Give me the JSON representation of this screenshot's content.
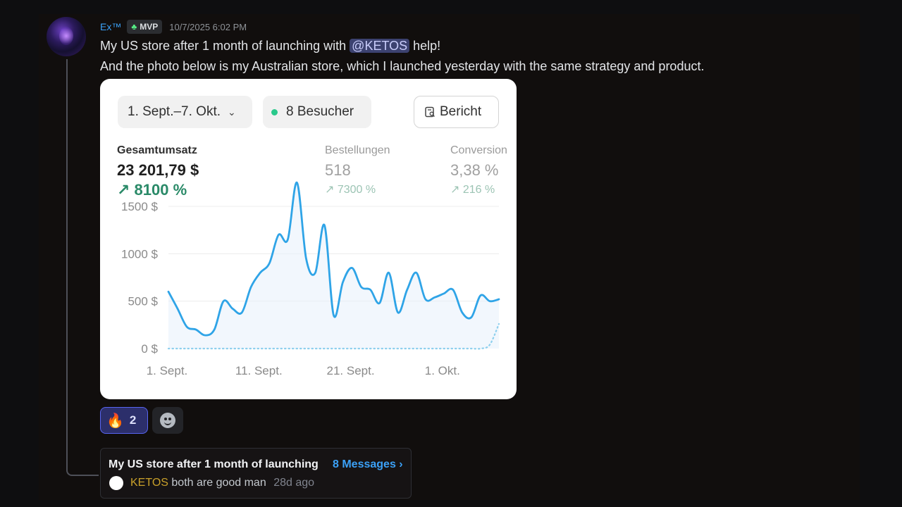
{
  "message": {
    "username": "Ex™",
    "badge_label": "MVP",
    "timestamp": "10/7/2025 6:02 PM",
    "line1_before": "My US store after 1 month of launching with ",
    "mention": "@KETOS",
    "line1_after": " help!",
    "line2": "And the photo below is my Australian store, which I launched yesterday with the same strategy and product."
  },
  "card": {
    "date_range": "1. Sept.–7. Okt.",
    "visitors": "8 Besucher",
    "report_label": "Bericht",
    "metrics": [
      {
        "label": "Gesamtumsatz",
        "value": "23 201,79 $",
        "change": "↗ 8100 %"
      },
      {
        "label": "Bestellungen",
        "value": "518",
        "change": "↗ 7300 %"
      },
      {
        "label": "Conversion",
        "value": "3,38 %",
        "change": "↗ 216 %"
      }
    ],
    "colors": {
      "line": "#2fa4e7",
      "dotted": "#8fd0ee",
      "accent": "#2a8a68"
    }
  },
  "chart_data": {
    "type": "line",
    "y_ticks": [
      "1500 $",
      "1000 $",
      "500 $",
      "0 $"
    ],
    "y_tick_values": [
      1500,
      1000,
      500,
      0
    ],
    "x_ticks": [
      "1. Sept.",
      "11. Sept.",
      "21. Sept.",
      "1. Okt."
    ],
    "x_tick_days": [
      1,
      11,
      21,
      31
    ],
    "ylim": [
      0,
      1750
    ],
    "xlim": [
      1,
      37
    ],
    "grid": true,
    "series": [
      {
        "x": [
          1,
          2,
          3,
          4,
          5,
          6,
          7,
          8,
          9,
          10,
          11,
          12,
          13,
          14,
          15,
          16,
          17,
          18,
          19,
          20,
          21,
          22,
          23,
          24,
          25,
          26,
          27,
          28,
          29,
          30,
          31,
          32,
          33,
          34,
          35,
          36,
          37
        ],
        "values": [
          600,
          420,
          230,
          200,
          140,
          200,
          500,
          420,
          380,
          650,
          800,
          900,
          1200,
          1150,
          1750,
          950,
          800,
          1300,
          350,
          700,
          850,
          650,
          620,
          480,
          800,
          380,
          620,
          800,
          520,
          540,
          580,
          620,
          380,
          330,
          560,
          500,
          520
        ]
      },
      {
        "x": [
          1,
          2,
          3,
          4,
          5,
          6,
          7,
          8,
          9,
          10,
          11,
          12,
          13,
          14,
          15,
          16,
          17,
          18,
          19,
          20,
          21,
          22,
          23,
          24,
          25,
          26,
          27,
          28,
          29,
          30,
          31,
          32,
          33,
          34,
          35,
          36,
          37
        ],
        "values": [
          0,
          0,
          0,
          0,
          0,
          0,
          0,
          0,
          0,
          0,
          0,
          0,
          0,
          0,
          0,
          0,
          0,
          0,
          0,
          0,
          0,
          0,
          0,
          0,
          0,
          0,
          0,
          0,
          0,
          0,
          0,
          0,
          0,
          0,
          0,
          40,
          260
        ]
      }
    ]
  },
  "reactions": {
    "fire_emoji": "🔥",
    "fire_count": "2",
    "add_icon": "add-reaction-icon"
  },
  "thread": {
    "title": "My US store after 1 month of launching",
    "count": "8 Messages ›",
    "reply_user": "KETOS",
    "reply_text": "both are good man",
    "reply_time": "28d ago"
  }
}
